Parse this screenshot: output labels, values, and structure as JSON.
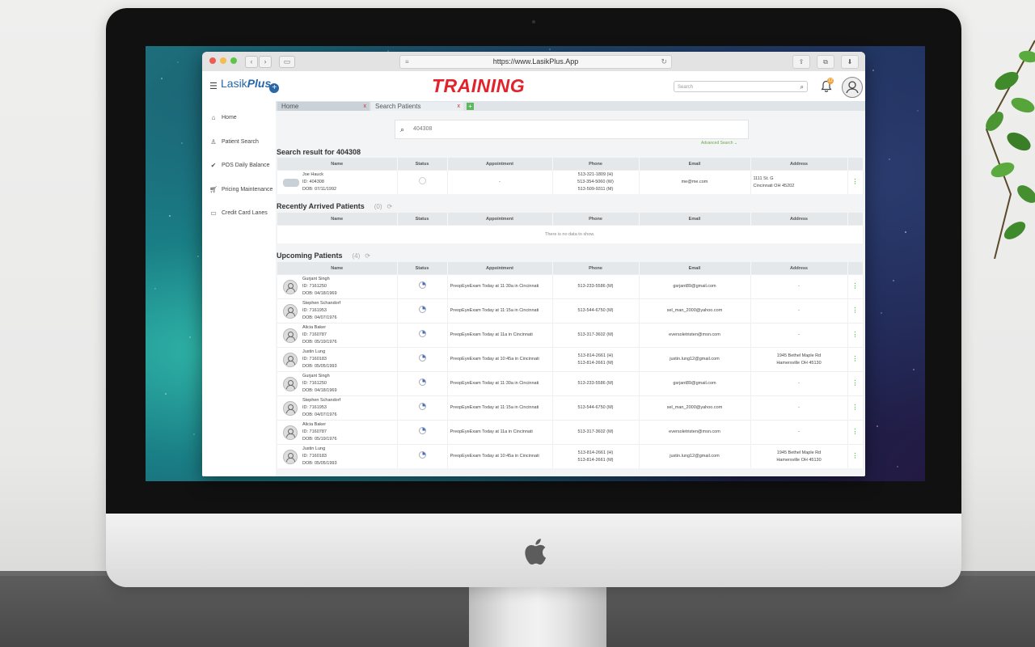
{
  "browser": {
    "url": "https://www.LasikPlus.App"
  },
  "header": {
    "logo_text": "Lasik",
    "logo_bold": "Plus",
    "logo_mark": "+",
    "env_banner": "TRAINING",
    "search_placeholder": "Search",
    "notification_count": "12"
  },
  "sidebar": {
    "items": [
      {
        "label": "Home",
        "icon": "home-icon"
      },
      {
        "label": "Patient Search",
        "icon": "person-icon"
      },
      {
        "label": "POS Daily Balance",
        "icon": "check-icon"
      },
      {
        "label": "Pricing Maintenance",
        "icon": "cart-icon"
      },
      {
        "label": "Credit Card Lanes",
        "icon": "card-icon"
      }
    ]
  },
  "tabs": [
    {
      "label": "Home",
      "close": "x"
    },
    {
      "label": "Search Patients",
      "close": "x"
    }
  ],
  "add_tab": "+",
  "search": {
    "value": "404308",
    "advanced": "Advanced Search ⌄"
  },
  "columns": [
    "Name",
    "Status",
    "Appointment",
    "Phone",
    "Email",
    "Address"
  ],
  "search_result": {
    "title": "Search result for 404308",
    "rows": [
      {
        "name": "Joe Hauck",
        "id": "ID: 404308",
        "dob": "DOB: 07/11/1992",
        "appointment": "-",
        "phone": [
          "513-321-1809 (H)",
          "513-354-5060 (W)",
          "513-509-9311 (M)"
        ],
        "email": "me@me.com",
        "address": [
          "1111 St. G",
          "Cincinnati OH 45202"
        ]
      }
    ]
  },
  "recently_arrived": {
    "title": "Recently Arrived Patients",
    "count": "(0)",
    "empty_text": "There is no data to show."
  },
  "upcoming": {
    "title": "Upcoming Patients",
    "count": "(4)",
    "rows": [
      {
        "name": "Gurjant Singh",
        "id": "ID: 7161250",
        "dob": "DOB: 04/18/1969",
        "appointment": "PreopEyeExam Today at 11:30a in Cincinnati",
        "phone": [
          "513-233-5586 (M)"
        ],
        "email": "gsrjant89@gmail.com",
        "address": [
          "-"
        ]
      },
      {
        "name": "Stephen Schandorf",
        "id": "ID: 7161953",
        "dob": "DOB: 04/07/1976",
        "appointment": "PreopEyeExam Today at 11:15a in Cincinnati",
        "phone": [
          "513-544-6750 (M)"
        ],
        "email": "sel_man_2000@yahoo.com",
        "address": [
          "-"
        ]
      },
      {
        "name": "Alicia Baker",
        "id": "ID: 7160787",
        "dob": "DOB: 05/19/1976",
        "appointment": "PreopEyeExam Today at 11a in Cincinnati",
        "phone": [
          "513-317-3602 (M)"
        ],
        "email": "eversoletristen@msn.com",
        "address": [
          "-"
        ]
      },
      {
        "name": "Justin Lung",
        "id": "ID: 7160183",
        "dob": "DOB: 05/05/1993",
        "appointment": "PreopEyeExam Today at 10:45a in Cincinnati",
        "phone": [
          "513-814-2661 (H)",
          "513-814-2661 (M)"
        ],
        "email": "justin.lung12@gmail.com",
        "address": [
          "1945 Bethel Maple Rd",
          "Hamersville OH 45130"
        ]
      },
      {
        "name": "Gurjant Singh",
        "id": "ID: 7161250",
        "dob": "DOB: 04/18/1969",
        "appointment": "PreopEyeExam Today at 11:30a in Cincinnati",
        "phone": [
          "513-233-5586 (M)"
        ],
        "email": "gsrjant89@gmail.com",
        "address": [
          "-"
        ]
      },
      {
        "name": "Stephen Schandorf",
        "id": "ID: 7161953",
        "dob": "DOB: 04/07/1976",
        "appointment": "PreopEyeExam Today at 11:15a in Cincinnati",
        "phone": [
          "513-544-6750 (M)"
        ],
        "email": "sel_man_2000@yahoo.com",
        "address": [
          "-"
        ]
      },
      {
        "name": "Alicia Baker",
        "id": "ID: 7160787",
        "dob": "DOB: 05/19/1976",
        "appointment": "PreopEyeExam Today at 11a in Cincinnati",
        "phone": [
          "513-317-3602 (M)"
        ],
        "email": "eversoletristen@msn.com",
        "address": [
          "-"
        ]
      },
      {
        "name": "Justin Lung",
        "id": "ID: 7160183",
        "dob": "DOB: 05/05/1993",
        "appointment": "PreopEyeExam Today at 10:45a in Cincinnati",
        "phone": [
          "513-814-2661 (H)",
          "513-814-2661 (M)"
        ],
        "email": "justin.lung12@gmail.com",
        "address": [
          "1945 Bethel Maple Rd",
          "Hamersville OH 45130"
        ]
      }
    ]
  },
  "colors": {
    "brand_blue": "#2a66a8",
    "training_red": "#e1232b",
    "action_green": "#5bb85d"
  }
}
